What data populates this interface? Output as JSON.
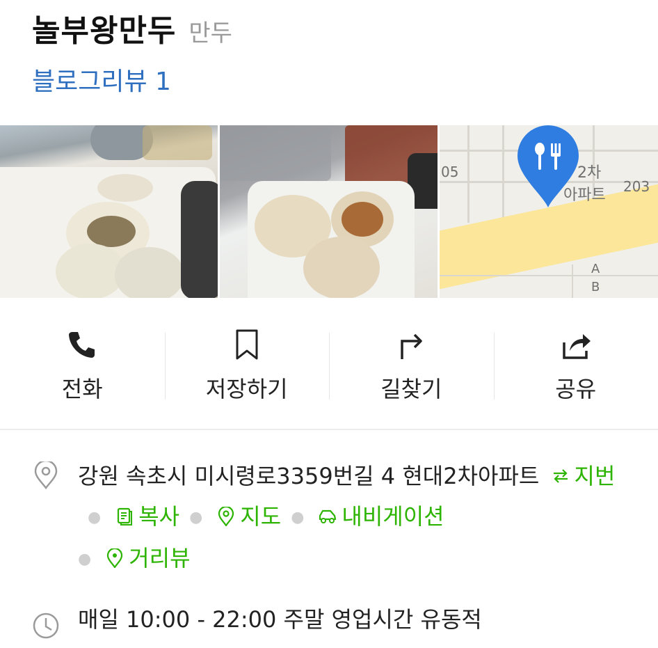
{
  "header": {
    "place_name": "놀부왕만두",
    "category": "만두",
    "review_link": "블로그리뷰 1"
  },
  "photos": {
    "map_labels": [
      "05",
      "2차",
      "아파트",
      "203",
      "A",
      "B"
    ],
    "map_pin_icon": "restaurant-pin-icon",
    "colors": {
      "pin": "#2f7de0",
      "road": "#fbe69a"
    }
  },
  "actions": [
    {
      "icon": "phone-icon",
      "label": "전화"
    },
    {
      "icon": "bookmark-icon",
      "label": "저장하기"
    },
    {
      "icon": "directions-icon",
      "label": "길찾기"
    },
    {
      "icon": "share-icon",
      "label": "공유"
    }
  ],
  "address": {
    "icon": "location-pin-icon",
    "text": "강원 속초시 미시령로3359번길 4 현대2차아파트",
    "links": [
      {
        "icon": "swap-icon",
        "label": "지번"
      },
      {
        "icon": "copy-icon",
        "label": "복사"
      },
      {
        "icon": "map-pin-icon",
        "label": "지도"
      },
      {
        "icon": "car-icon",
        "label": "내비게이션"
      },
      {
        "icon": "street-view-icon",
        "label": "거리뷰"
      }
    ],
    "link_color": "#2db400"
  },
  "hours": {
    "icon": "clock-icon",
    "text": "매일 10:00 - 22:00 주말 영업시간 유동적"
  }
}
